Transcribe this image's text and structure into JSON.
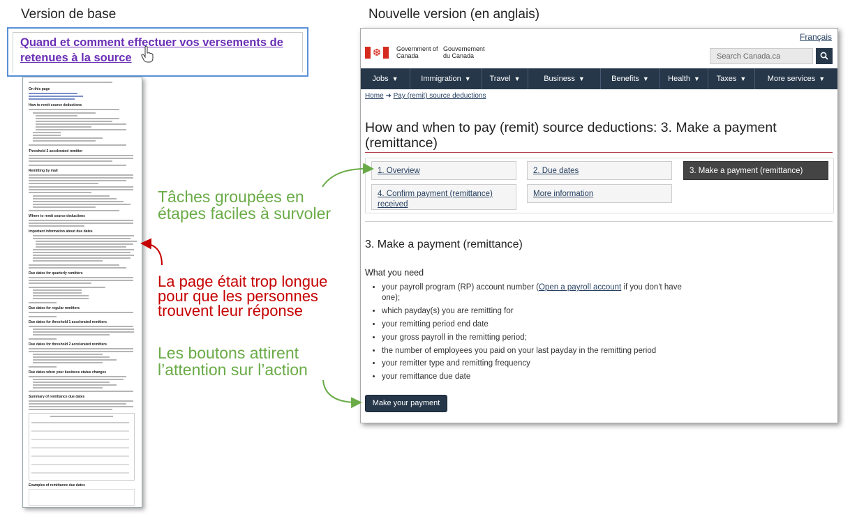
{
  "headers": {
    "left": "Version de base",
    "right": "Nouvelle version (en anglais)"
  },
  "old_page": {
    "link_title": "Quand et comment effectuer vos versements de retenues à la source"
  },
  "annotations": {
    "steps_note": "Tâches groupées en étapes faciles à survoler",
    "too_long_note": "La page était trop longue pour que les personnes trouvent leur réponse",
    "buttons_note": "Les boutons attirent l’attention sur l’action"
  },
  "colors": {
    "annotation_green": "#6aab47",
    "annotation_red": "#c60000",
    "canada_nav": "#26374a",
    "callout_border": "#5a8fd6"
  },
  "new_page": {
    "language_link": "Français",
    "gov_en": "Government of Canada",
    "gov_fr": "Gouvernement du Canada",
    "search_placeholder": "Search Canada.ca",
    "search_icon": "magnifier-icon",
    "menu": [
      "Jobs",
      "Immigration",
      "Travel",
      "Business",
      "Benefits",
      "Health",
      "Taxes",
      "More services"
    ],
    "breadcrumb": [
      "Home",
      "Pay (remit) source deductions"
    ],
    "title": "How and when to pay (remit) source deductions: 3. Make a payment (remittance)",
    "steps": [
      "1. Overview",
      "2. Due dates",
      "3. Make a payment (remittance)",
      "4. Confirm payment (remittance) received",
      "More information"
    ],
    "active_step": "3. Make a payment (remittance)",
    "section_title": "3. Make a payment (remittance)",
    "subsection_title": "What you need",
    "needs": {
      "item0_before": "your payroll program (RP) account number (",
      "item0_link": "Open a payroll account",
      "item0_after": " if you don't have one);",
      "item1": "which payday(s) you are remitting for",
      "item2": "your remitting period end date",
      "item3": "your gross payroll in the remitting period;",
      "item4": "the number of employees you paid on your last payday in the remitting period",
      "item5": "your remitter type and remitting frequency",
      "item6": "your remittance due date"
    },
    "button": "Make your payment"
  }
}
